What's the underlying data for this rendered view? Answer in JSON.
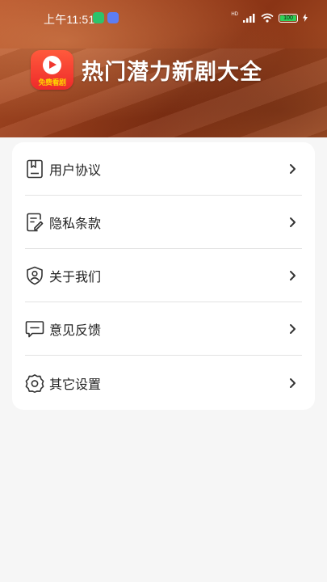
{
  "status_bar": {
    "time": "上午11:51",
    "network_badge": "HD",
    "battery_level": "100",
    "battery_color": "#2fd158"
  },
  "header": {
    "logo_text": "免费看剧",
    "title": "热门潜力新剧大全",
    "brand_color": "#ee2a2a"
  },
  "menu": {
    "items": [
      {
        "label": "用户协议",
        "icon": "document-icon"
      },
      {
        "label": "隐私条款",
        "icon": "edit-document-icon"
      },
      {
        "label": "关于我们",
        "icon": "shield-user-icon"
      },
      {
        "label": "意见反馈",
        "icon": "message-icon"
      },
      {
        "label": "其它设置",
        "icon": "gear-icon"
      }
    ]
  }
}
